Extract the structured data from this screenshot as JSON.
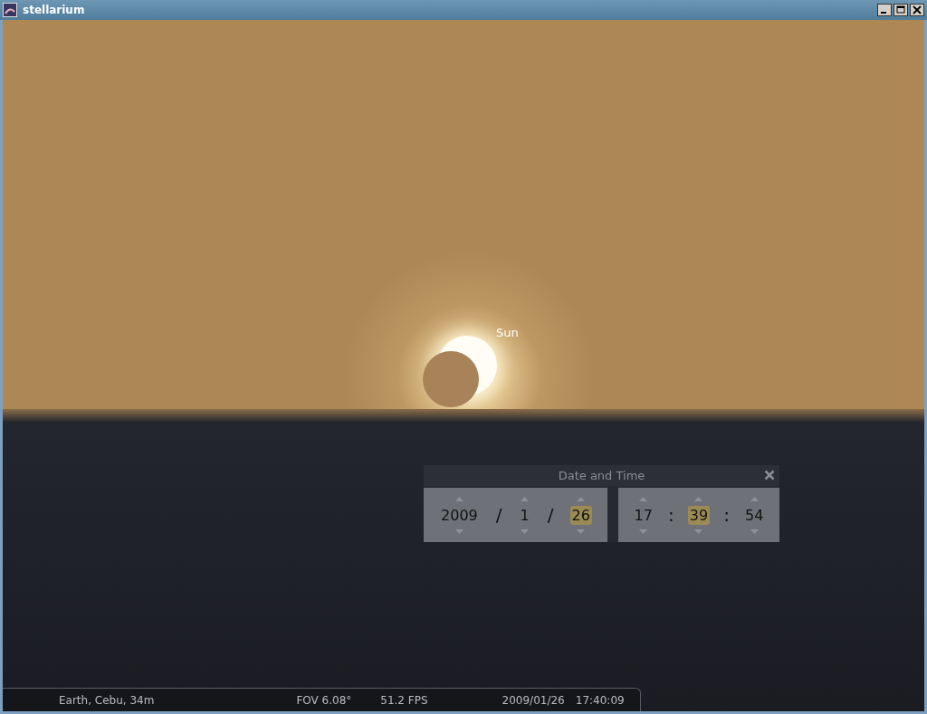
{
  "window": {
    "title": "stellarium"
  },
  "sky": {
    "object_label": "Sun"
  },
  "date_time_dialog": {
    "title": "Date and Time",
    "date_fields": [
      {
        "value": "2009",
        "selected": false
      },
      {
        "value": "1",
        "selected": false
      },
      {
        "value": "26",
        "selected": true
      }
    ],
    "date_separators": [
      "/",
      "/"
    ],
    "time_fields": [
      {
        "value": "17",
        "selected": false
      },
      {
        "value": "39",
        "selected": true
      },
      {
        "value": "54",
        "selected": false
      }
    ],
    "time_separators": [
      ":",
      ":"
    ]
  },
  "status_bar": {
    "location": "Earth, Cebu, 34m",
    "fov": "FOV 6.08°",
    "fps": "51.2 FPS",
    "date": "2009/01/26",
    "time": "17:40:09"
  }
}
